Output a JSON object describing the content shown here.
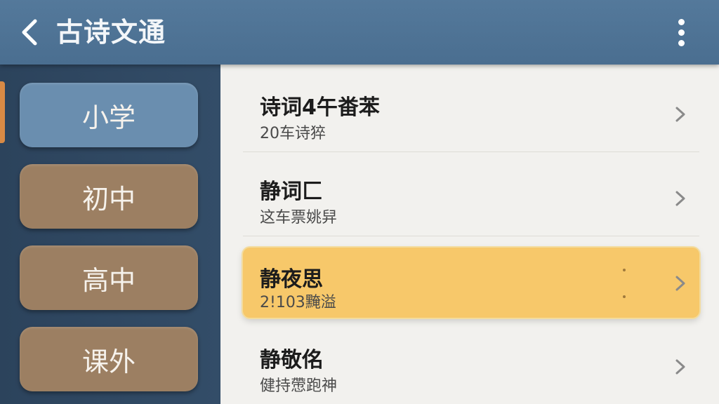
{
  "header": {
    "title": "古诗文通",
    "back_icon": "chevron-left-icon",
    "more_icon": "more-vertical-icon"
  },
  "sidebar": {
    "items": [
      {
        "label": "小学",
        "state": "active"
      },
      {
        "label": "初中",
        "state": "normal"
      },
      {
        "label": "高中",
        "state": "normal"
      },
      {
        "label": "课外",
        "state": "normal"
      }
    ]
  },
  "list": {
    "items": [
      {
        "title": "诗词4午畨苯",
        "subtitle": "20车诗猝",
        "highlighted": false
      },
      {
        "title": "静词匚",
        "subtitle": "这车票姚舁",
        "highlighted": false
      },
      {
        "title": "静夜思",
        "subtitle": "2!103黤溢",
        "highlighted": true
      },
      {
        "title": "静敬佲",
        "subtitle": "健持慸跑神",
        "highlighted": false
      }
    ]
  },
  "colors": {
    "header_bg": "#4f7495",
    "sidebar_bg": "#2e4660",
    "sidebar_active": "#6a8eaf",
    "sidebar_normal": "#9c7f62",
    "indicator": "#d88a45",
    "list_bg": "#f2f1ee",
    "highlight": "#f7c86a"
  }
}
